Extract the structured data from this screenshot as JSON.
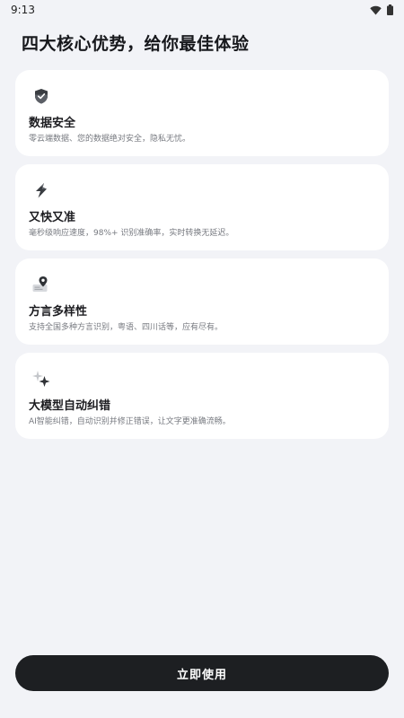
{
  "status_bar": {
    "time": "9:13",
    "icons": [
      "wifi-icon",
      "battery-icon"
    ]
  },
  "page": {
    "title": "四大核心优势，给你最佳体验"
  },
  "features": [
    {
      "icon": "shield-check-icon",
      "title": "数据安全",
      "description": "零云端数据、您的数据绝对安全，隐私无忧。"
    },
    {
      "icon": "lightning-icon",
      "title": "又快又准",
      "description": "毫秒级响应速度，98%+ 识别准确率，实时转换无延迟。"
    },
    {
      "icon": "map-pin-icon",
      "title": "方言多样性",
      "description": "支持全国多种方言识别，粤语、四川话等，应有尽有。"
    },
    {
      "icon": "sparkle-icon",
      "title": "大模型自动纠错",
      "description": "AI智能纠错，自动识别并修正错误，让文字更准确流畅。"
    }
  ],
  "actions": {
    "start_label": "立即使用"
  },
  "colors": {
    "background": "#f2f3f7",
    "card": "#ffffff",
    "button": "#1d1f22",
    "button_text": "#ffffff",
    "description": "#777a80"
  }
}
